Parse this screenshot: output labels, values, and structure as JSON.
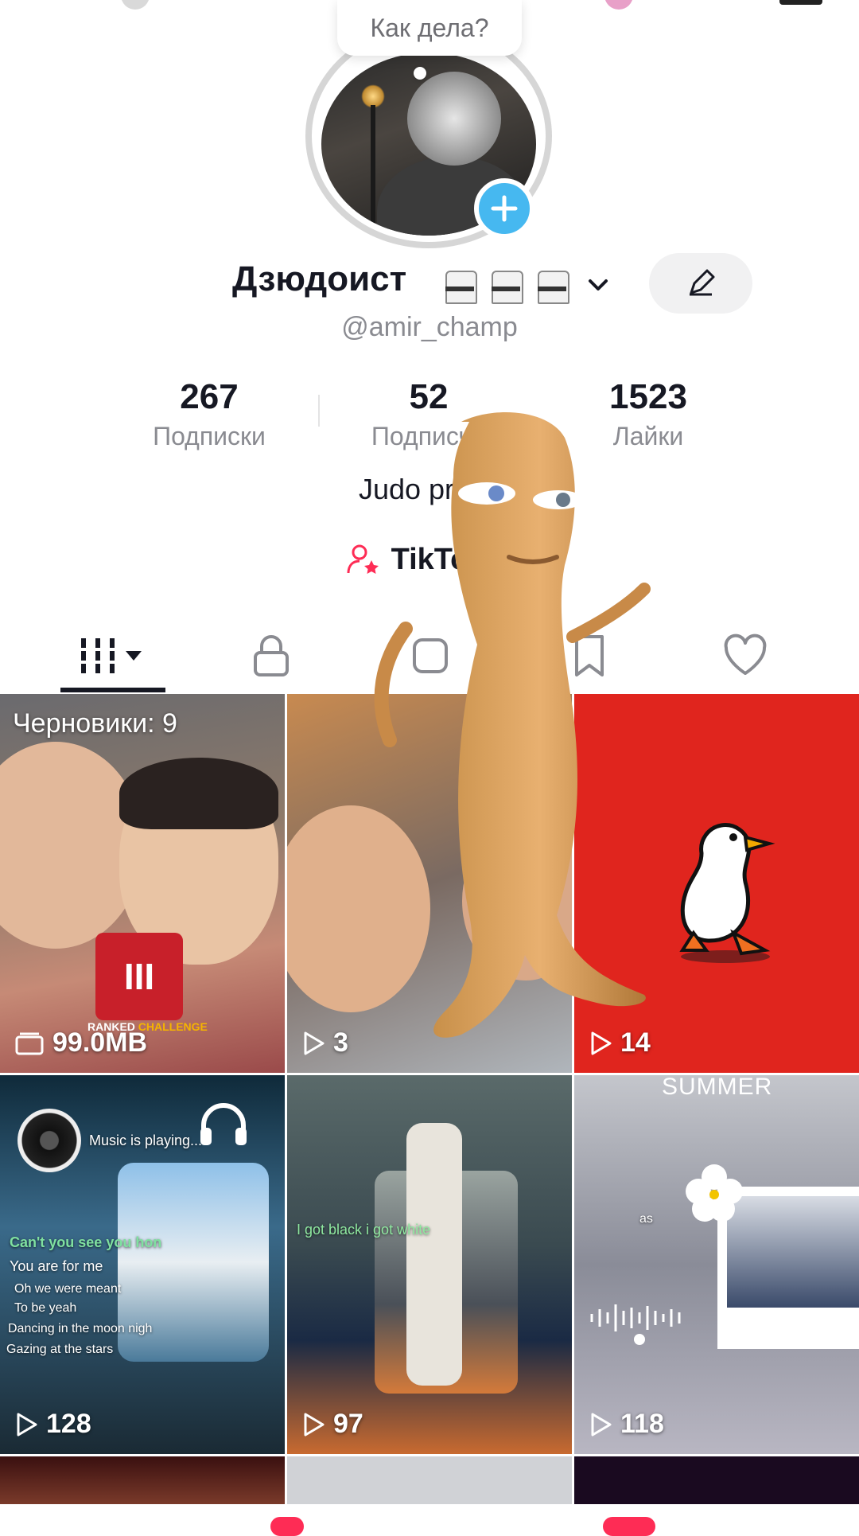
{
  "bubble": {
    "text": "Как дела?"
  },
  "profile": {
    "name": "Дзюдоист",
    "handle": "@amir_champ",
    "bio": "Judo prime",
    "link_label": "TikTok S"
  },
  "stats": [
    {
      "value": "267",
      "label": "Подписки"
    },
    {
      "value": "52",
      "label": "Подписчи"
    },
    {
      "value": "1523",
      "label": "Лайки"
    }
  ],
  "tabs": [
    "videos-grid",
    "private",
    "reposts",
    "saved",
    "liked"
  ],
  "grid": {
    "drafts_label": "Черновики: 9",
    "cells": [
      {
        "count": "99.0MB",
        "icon": "drafts-icon"
      },
      {
        "count": "3",
        "icon": "play-icon"
      },
      {
        "count": "14",
        "icon": "play-icon"
      },
      {
        "count": "128",
        "icon": "play-icon"
      },
      {
        "count": "97",
        "icon": "play-icon"
      },
      {
        "count": "118",
        "icon": "play-icon"
      }
    ],
    "overlay_summer": "SUMMER",
    "overlay_ranked_1": "RANKED",
    "overlay_ranked_2": "CHALLENGE",
    "overlay_ranked_num": "III",
    "overlay_music": "Music is playing...",
    "overlay_lyrics": [
      "Can't you see you hon",
      "You are for me",
      "Oh we were meant",
      "To be yeah",
      "Dancing in the moon nigh",
      "Gazing at the stars"
    ],
    "overlay_gotblack": "I got black i got white",
    "overlay_as": "as"
  },
  "colors": {
    "accent": "#fe2c55",
    "blue": "#46b8f0",
    "duck_bg": "#e0251e"
  }
}
